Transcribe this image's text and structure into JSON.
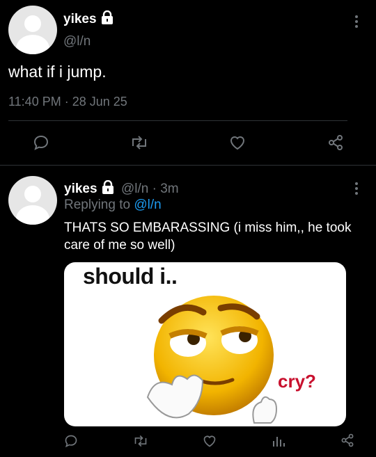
{
  "main_tweet": {
    "display_name": "yikes",
    "handle": "@l/n",
    "text": "what if i jump.",
    "timestamp": "11:40 PM · 28 Jun 25"
  },
  "reply": {
    "display_name": "yikes",
    "handle_time": "@l/n · 3m",
    "replying_prefix": "Replying to",
    "replying_handle": "@l/n",
    "text": "THATS SO EMBARASSING (i miss him,, he took care of me so well)",
    "meme_text_top": "should i..",
    "meme_text_side": "cry?"
  },
  "actions": [
    "comment-icon",
    "retweet-icon",
    "like-icon",
    "analytics-icon",
    "share-icon"
  ],
  "colors": {
    "background": "#000000",
    "secondary_text": "#71767b",
    "link": "#1d9bf0"
  }
}
